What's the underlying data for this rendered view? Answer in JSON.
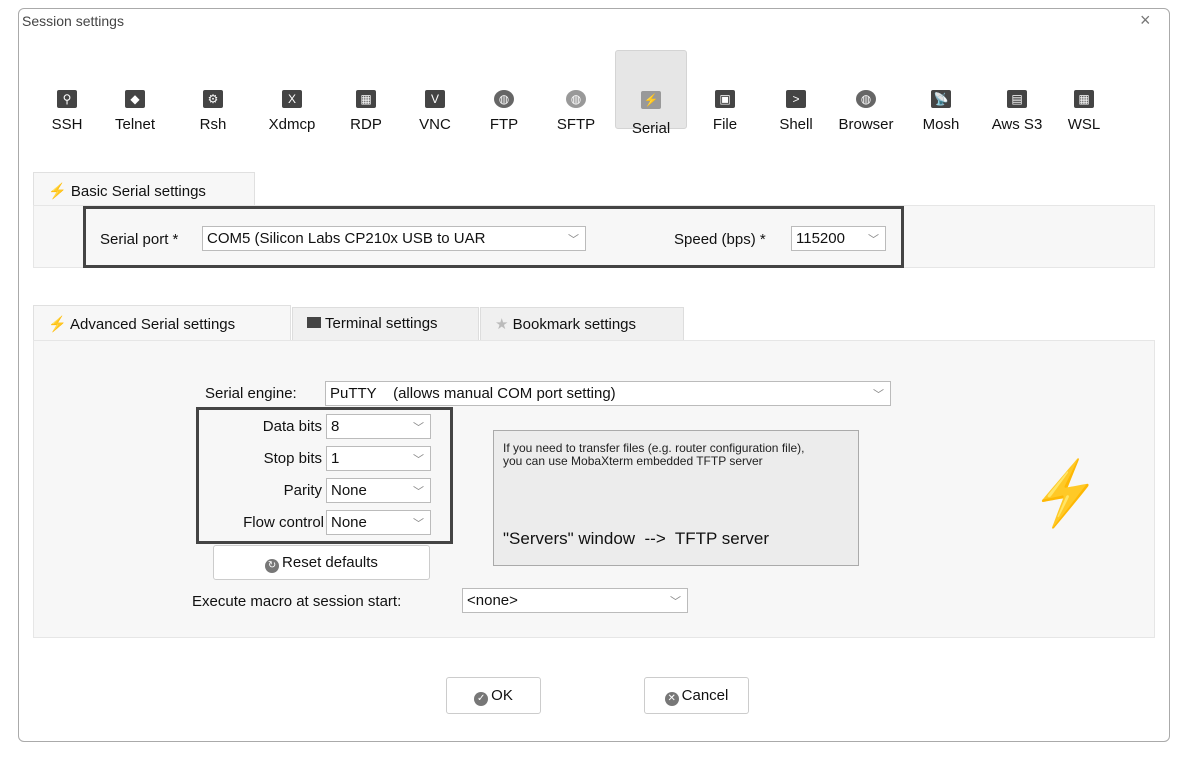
{
  "window": {
    "title": "Session settings",
    "close": "×"
  },
  "session_types": [
    {
      "label": "SSH",
      "glyph": "⚲"
    },
    {
      "label": "Telnet",
      "glyph": "◆"
    },
    {
      "label": "Rsh",
      "glyph": "⚙"
    },
    {
      "label": "Xdmcp",
      "glyph": "X"
    },
    {
      "label": "RDP",
      "glyph": "▦"
    },
    {
      "label": "VNC",
      "glyph": "V"
    },
    {
      "label": "FTP",
      "glyph": "◍"
    },
    {
      "label": "SFTP",
      "glyph": "◍"
    },
    {
      "label": "Serial",
      "glyph": "⚡"
    },
    {
      "label": "File",
      "glyph": "▣"
    },
    {
      "label": "Shell",
      "glyph": ">"
    },
    {
      "label": "Browser",
      "glyph": "◍"
    },
    {
      "label": "Mosh",
      "glyph": "📡"
    },
    {
      "label": "Aws S3",
      "glyph": "▤"
    },
    {
      "label": "WSL",
      "glyph": "▦"
    }
  ],
  "selected_type": "Serial",
  "basic": {
    "tab": "Basic Serial settings",
    "serial_port_label": "Serial port *",
    "serial_port_value": "COM5  (Silicon Labs CP210x USB to UAR",
    "speed_label": "Speed (bps) *",
    "speed_value": "115200"
  },
  "advanced_tabs": [
    "Advanced Serial settings",
    "Terminal settings",
    "Bookmark settings"
  ],
  "advanced": {
    "engine_label": "Serial engine:",
    "engine_value": "PuTTY    (allows manual COM port setting)",
    "data_bits_label": "Data bits",
    "data_bits_value": "8",
    "stop_bits_label": "Stop bits",
    "stop_bits_value": "1",
    "parity_label": "Parity",
    "parity_value": "None",
    "flow_label": "Flow control",
    "flow_value": "None",
    "reset_label": "Reset defaults",
    "info_text": "If you need to transfer files (e.g. router configuration file), you can use MobaXterm embedded TFTP server",
    "info_hint": "\"Servers\" window  -->  TFTP server",
    "macro_label": "Execute macro at session start:",
    "macro_value": "<none>"
  },
  "buttons": {
    "ok": "OK",
    "cancel": "Cancel"
  }
}
